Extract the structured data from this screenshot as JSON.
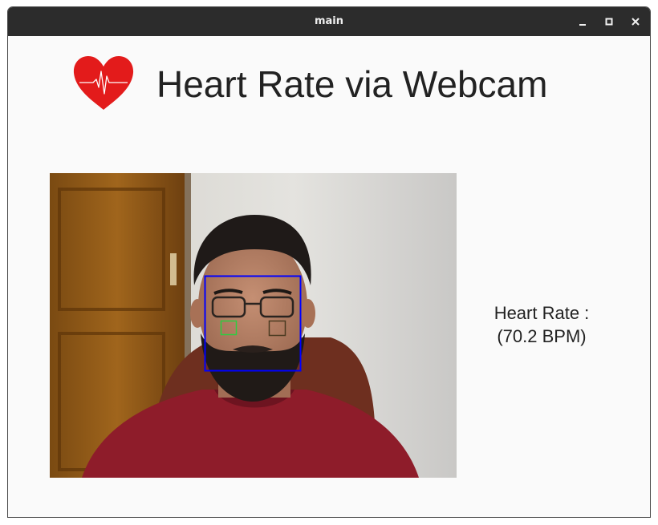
{
  "window": {
    "title": "main",
    "controls": [
      "minimize-icon",
      "maximize-icon",
      "close-icon"
    ]
  },
  "header": {
    "logo_icon": "heart-ecg-icon",
    "title": "Heart Rate via Webcam"
  },
  "webcam": {
    "face_box_color": "#0000ff",
    "left_roi_color": "#2ecc40",
    "right_roi_color": "#4a3a20"
  },
  "readout": {
    "label": "Heart Rate :",
    "value": "(70.2 BPM)"
  },
  "colors": {
    "titlebar": "#2c2c2c",
    "background": "#fafafa",
    "heart": "#e31b1b",
    "text": "#222222"
  }
}
